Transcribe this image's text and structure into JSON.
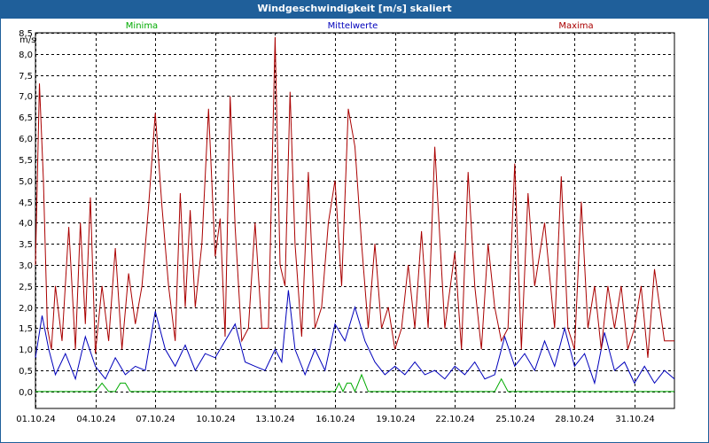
{
  "window": {
    "title": "Windgeschwindigkeit [m/s] skaliert"
  },
  "chart_data": {
    "type": "line",
    "title": "Windgeschwindigkeit [m/s] skaliert",
    "ylabel": "m/s",
    "xlabel": "",
    "ylim": [
      -0.4,
      8.5
    ],
    "xlim": [
      "2024-10-01",
      "2024-11-02"
    ],
    "grid": true,
    "legend_position": "top",
    "y_ticks": [
      "0,0",
      "0,5",
      "1,0",
      "1,5",
      "2,0",
      "2,5",
      "3,0",
      "3,5",
      "4,0",
      "4,5",
      "5,0",
      "5,5",
      "6,0",
      "6,5",
      "7,0",
      "7,5",
      "8,0",
      "8,5"
    ],
    "x_ticks": [
      "01.10.24",
      "04.10.24",
      "07.10.24",
      "10.10.24",
      "13.10.24",
      "16.10.24",
      "19.10.24",
      "22.10.24",
      "25.10.24",
      "28.10.24",
      "31.10.24"
    ],
    "series": [
      {
        "name": "Minima",
        "color": "#00aa00",
        "x": [
          "2024-10-01",
          "2024-10-04",
          "2024-10-04",
          "2024-10-04",
          "2024-10-05",
          "2024-10-05",
          "2024-10-05",
          "2024-10-05",
          "2024-10-16",
          "2024-10-16",
          "2024-10-16",
          "2024-10-16",
          "2024-10-16",
          "2024-10-17",
          "2024-10-17",
          "2024-10-17",
          "2024-10-24",
          "2024-10-24",
          "2024-10-24",
          "2024-11-02"
        ],
        "y": [
          0,
          0,
          0.2,
          0,
          0,
          0.2,
          0.2,
          0,
          0,
          0.2,
          0,
          0.2,
          0.2,
          0,
          0.4,
          0,
          0,
          0.3,
          0,
          0
        ]
      },
      {
        "name": "Mittelwerte",
        "color": "#0000bb",
        "x": [
          "2024-10-01",
          "2024-10-01",
          "2024-10-01",
          "2024-10-02",
          "2024-10-02",
          "2024-10-03",
          "2024-10-03",
          "2024-10-04",
          "2024-10-04",
          "2024-10-05",
          "2024-10-05",
          "2024-10-06",
          "2024-10-06",
          "2024-10-07",
          "2024-10-07",
          "2024-10-08",
          "2024-10-08",
          "2024-10-09",
          "2024-10-09",
          "2024-10-10",
          "2024-10-10",
          "2024-10-11",
          "2024-10-11",
          "2024-10-12",
          "2024-10-12",
          "2024-10-13",
          "2024-10-13",
          "2024-10-13",
          "2024-10-14",
          "2024-10-14",
          "2024-10-15",
          "2024-10-15",
          "2024-10-16",
          "2024-10-16",
          "2024-10-17",
          "2024-10-17",
          "2024-10-18",
          "2024-10-18",
          "2024-10-19",
          "2024-10-19",
          "2024-10-20",
          "2024-10-20",
          "2024-10-21",
          "2024-10-21",
          "2024-10-22",
          "2024-10-22",
          "2024-10-23",
          "2024-10-23",
          "2024-10-24",
          "2024-10-24",
          "2024-10-25",
          "2024-10-25",
          "2024-10-26",
          "2024-10-26",
          "2024-10-27",
          "2024-10-27",
          "2024-10-28",
          "2024-10-28",
          "2024-10-29",
          "2024-10-29",
          "2024-10-30",
          "2024-10-30",
          "2024-10-31",
          "2024-10-31",
          "2024-11-01",
          "2024-11-01",
          "2024-11-02"
        ],
        "y": [
          0.8,
          1.8,
          1.0,
          0.4,
          0.9,
          0.3,
          1.3,
          0.6,
          0.3,
          0.8,
          0.4,
          0.6,
          0.5,
          1.9,
          1.0,
          0.6,
          1.1,
          0.5,
          0.9,
          0.8,
          1.2,
          1.6,
          0.7,
          0.6,
          0.5,
          1.0,
          0.7,
          2.4,
          1.0,
          0.4,
          1.0,
          0.5,
          1.6,
          1.2,
          2.0,
          1.2,
          0.7,
          0.4,
          0.6,
          0.4,
          0.7,
          0.4,
          0.5,
          0.3,
          0.6,
          0.4,
          0.7,
          0.3,
          0.4,
          1.3,
          0.6,
          0.9,
          0.5,
          1.2,
          0.6,
          1.5,
          0.6,
          0.9,
          0.2,
          1.4,
          0.5,
          0.7,
          0.2,
          0.6,
          0.2,
          0.5,
          0.3
        ]
      },
      {
        "name": "Maxima",
        "color": "#aa0000",
        "x": [
          "2024-10-01",
          "2024-10-01",
          "2024-10-01",
          "2024-10-01",
          "2024-10-01",
          "2024-10-02",
          "2024-10-02",
          "2024-10-02",
          "2024-10-03",
          "2024-10-03",
          "2024-10-03",
          "2024-10-03",
          "2024-10-04",
          "2024-10-04",
          "2024-10-04",
          "2024-10-05",
          "2024-10-05",
          "2024-10-05",
          "2024-10-06",
          "2024-10-06",
          "2024-10-06",
          "2024-10-07",
          "2024-10-07",
          "2024-10-07",
          "2024-10-08",
          "2024-10-08",
          "2024-10-08",
          "2024-10-08",
          "2024-10-09",
          "2024-10-09",
          "2024-10-09",
          "2024-10-10",
          "2024-10-10",
          "2024-10-10",
          "2024-10-10",
          "2024-10-11",
          "2024-10-11",
          "2024-10-11",
          "2024-10-12",
          "2024-10-12",
          "2024-10-12",
          "2024-10-13",
          "2024-10-13",
          "2024-10-13",
          "2024-10-13",
          "2024-10-14",
          "2024-10-14",
          "2024-10-14",
          "2024-10-15",
          "2024-10-15",
          "2024-10-15",
          "2024-10-16",
          "2024-10-16",
          "2024-10-16",
          "2024-10-17",
          "2024-10-17",
          "2024-10-17",
          "2024-10-18",
          "2024-10-18",
          "2024-10-18",
          "2024-10-19",
          "2024-10-19",
          "2024-10-19",
          "2024-10-20",
          "2024-10-20",
          "2024-10-20",
          "2024-10-21",
          "2024-10-21",
          "2024-10-22",
          "2024-10-22",
          "2024-10-22",
          "2024-10-23",
          "2024-10-23",
          "2024-10-23",
          "2024-10-24",
          "2024-10-24",
          "2024-10-24",
          "2024-10-25",
          "2024-10-25",
          "2024-10-25",
          "2024-10-26",
          "2024-10-26",
          "2024-10-27",
          "2024-10-27",
          "2024-10-27",
          "2024-10-28",
          "2024-10-28",
          "2024-10-28",
          "2024-10-29",
          "2024-10-29",
          "2024-10-29",
          "2024-10-30",
          "2024-10-30",
          "2024-10-30",
          "2024-10-31",
          "2024-10-31",
          "2024-10-31",
          "2024-11-01",
          "2024-11-01",
          "2024-11-02"
        ],
        "y": [
          3.0,
          7.3,
          5.0,
          1.5,
          1.0,
          2.5,
          1.2,
          3.9,
          1.0,
          4.0,
          1.6,
          4.6,
          0.9,
          2.5,
          1.2,
          3.4,
          1.0,
          2.8,
          1.6,
          2.5,
          4.4,
          6.6,
          4.4,
          2.5,
          1.2,
          4.7,
          2.0,
          4.3,
          2.0,
          3.5,
          6.7,
          3.2,
          4.1,
          1.3,
          7.0,
          3.9,
          1.2,
          1.5,
          4.0,
          1.5,
          1.5,
          8.4,
          3.0,
          2.5,
          7.1,
          3.5,
          1.3,
          5.2,
          1.5,
          2.0,
          4.0,
          5.0,
          2.5,
          6.7,
          5.8,
          3.5,
          1.5,
          3.5,
          1.5,
          2.0,
          1.0,
          1.5,
          3.0,
          1.5,
          3.8,
          1.5,
          5.8,
          1.5,
          3.3,
          1.0,
          5.2,
          2.5,
          1.0,
          3.5,
          2.0,
          1.2,
          1.5,
          5.4,
          1.0,
          4.7,
          2.5,
          4.0,
          1.5,
          5.1,
          1.5,
          1.0,
          4.5,
          1.5,
          2.5,
          1.0,
          2.5,
          1.5,
          2.5,
          1.0,
          1.5,
          2.5,
          0.8,
          2.9,
          1.2,
          1.2
        ]
      }
    ]
  }
}
